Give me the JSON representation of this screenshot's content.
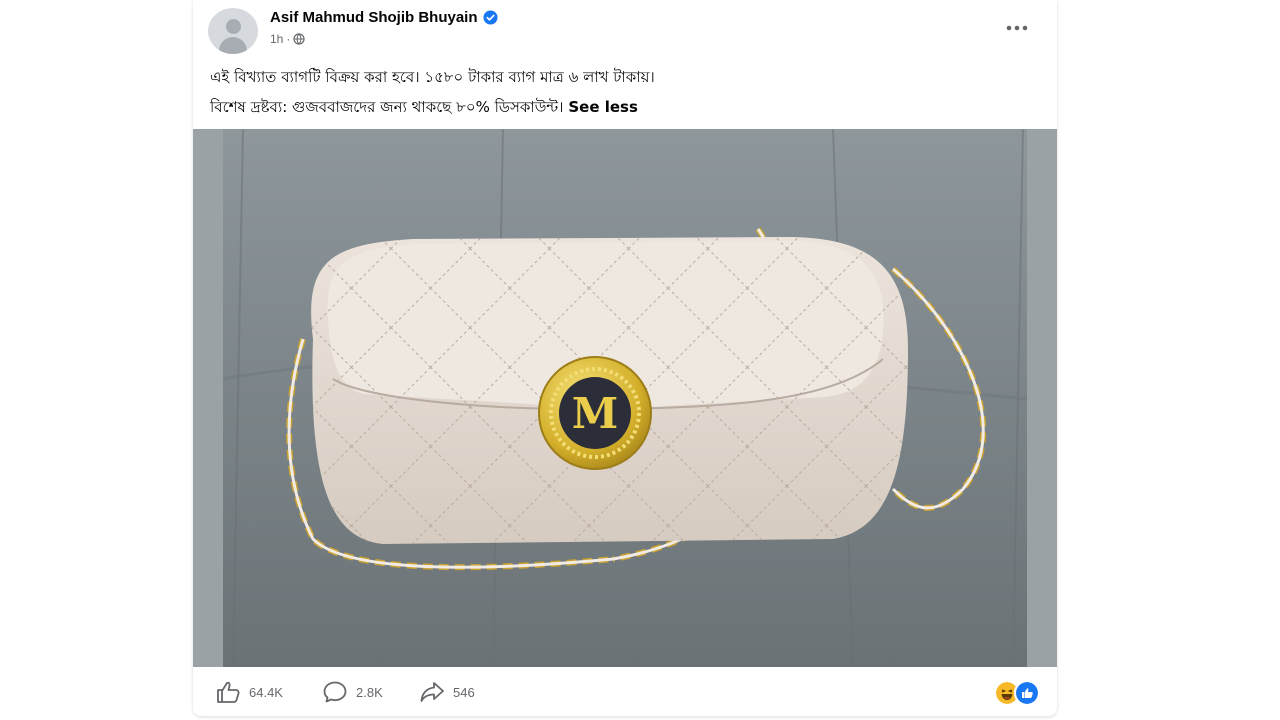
{
  "post": {
    "author": "Asif Mahmud Shojib Bhuyain",
    "time": "1h",
    "separator": "·",
    "caption_line1": "এই বিখ্যাত ব্যাগটি বিক্রয় করা হবে। ১৫৮০ টাকার ব্যাগ মাত্র ৬ লাখ টাকায়।",
    "caption_line2": "বিশেষ দ্রষ্টব্য: গুজববাজদের জন্য থাকছে ৮০% ডিসকাউন্ট।",
    "see_less": "See less",
    "image_logo_letter": "M"
  },
  "stats": {
    "likes": "64.4K",
    "comments": "2.8K",
    "shares": "546"
  },
  "icons": {
    "verified": "verified-badge-icon",
    "privacy": "globe-icon",
    "more": "more-options-icon",
    "like": "thumbs-up-icon",
    "comment": "comment-bubble-icon",
    "share": "share-arrow-icon",
    "reactions": [
      "haha-reaction-icon",
      "like-reaction-icon"
    ]
  },
  "colors": {
    "verified_blue": "#1877f2",
    "text_secondary": "#65676b",
    "reaction_yellow": "#f7b928",
    "reaction_blue": "#1877f2"
  }
}
